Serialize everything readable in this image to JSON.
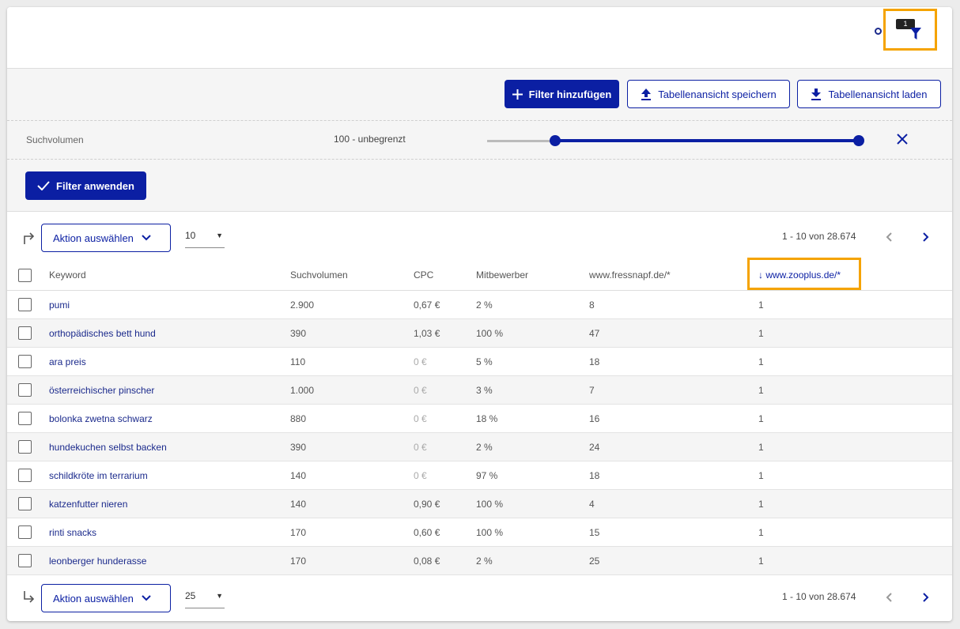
{
  "topbar": {
    "filter_badge": "1"
  },
  "filter_toolbar": {
    "add_filter_label": "Filter hinzufügen",
    "save_view_label": "Tabellenansicht speichern",
    "load_view_label": "Tabellenansicht laden"
  },
  "filters": {
    "search_volume_label": "Suchvolumen",
    "search_volume_range": "100 - unbegrenzt",
    "apply_label": "Filter anwenden"
  },
  "table_controls_top": {
    "action_label": "Aktion auswählen",
    "per_page": "10",
    "pagination": "1 - 10 von 28.674"
  },
  "table_controls_bottom": {
    "action_label": "Aktion auswählen",
    "per_page": "25",
    "pagination": "1 - 10 von 28.674"
  },
  "table": {
    "columns": [
      "Keyword",
      "Suchvolumen",
      "CPC",
      "Mitbewerber",
      "www.fressnapf.de/*",
      "www.zooplus.de/*"
    ],
    "sorted_column_indicator": "↓",
    "rows": [
      {
        "keyword": "pumi",
        "volume": "2.900",
        "cpc": "0,67 €",
        "competition": "2 %",
        "fressnapf": "8",
        "zooplus": "1"
      },
      {
        "keyword": "orthopädisches bett hund",
        "volume": "390",
        "cpc": "1,03 €",
        "competition": "100 %",
        "fressnapf": "47",
        "zooplus": "1"
      },
      {
        "keyword": "ara preis",
        "volume": "110",
        "cpc": "0 €",
        "competition": "5 %",
        "fressnapf": "18",
        "zooplus": "1"
      },
      {
        "keyword": "österreichischer pinscher",
        "volume": "1.000",
        "cpc": "0 €",
        "competition": "3 %",
        "fressnapf": "7",
        "zooplus": "1"
      },
      {
        "keyword": "bolonka zwetna schwarz",
        "volume": "880",
        "cpc": "0 €",
        "competition": "18 %",
        "fressnapf": "16",
        "zooplus": "1"
      },
      {
        "keyword": "hundekuchen selbst backen",
        "volume": "390",
        "cpc": "0 €",
        "competition": "2 %",
        "fressnapf": "24",
        "zooplus": "1"
      },
      {
        "keyword": "schildkröte im terrarium",
        "volume": "140",
        "cpc": "0 €",
        "competition": "97 %",
        "fressnapf": "18",
        "zooplus": "1"
      },
      {
        "keyword": "katzenfutter nieren",
        "volume": "140",
        "cpc": "0,90 €",
        "competition": "100 %",
        "fressnapf": "4",
        "zooplus": "1"
      },
      {
        "keyword": "rinti snacks",
        "volume": "170",
        "cpc": "0,60 €",
        "competition": "100 %",
        "fressnapf": "15",
        "zooplus": "1"
      },
      {
        "keyword": "leonberger hunderasse",
        "volume": "170",
        "cpc": "0,08 €",
        "competition": "2 %",
        "fressnapf": "25",
        "zooplus": "1"
      }
    ]
  },
  "colors": {
    "primary": "#0b1fa3",
    "highlight": "#f5a300"
  }
}
